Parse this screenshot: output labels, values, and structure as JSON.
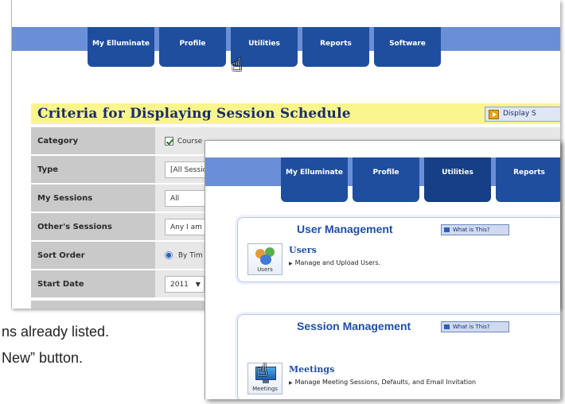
{
  "back_screen": {
    "nav_tabs": [
      "My Elluminate",
      "Profile",
      "Utilities",
      "Reports",
      "Software"
    ],
    "criteria_title": "Criteria for Displaying Session Schedule",
    "display_button": "Display S",
    "rows": [
      {
        "label": "Category",
        "value": "Course"
      },
      {
        "label": "Type",
        "value": "[All Sessio"
      },
      {
        "label": "My Sessions",
        "value": "All"
      },
      {
        "label": "Other's Sessions",
        "value": "Any I am"
      },
      {
        "label": "Sort Order",
        "value": "By Tim"
      },
      {
        "label": "Start Date",
        "value": "2011"
      }
    ]
  },
  "captions": {
    "line1": "ns already listed.",
    "line2": "New” button."
  },
  "front_screen": {
    "nav_tabs": [
      "My Elluminate",
      "Profile",
      "Utilities",
      "Reports"
    ],
    "user_panel": {
      "title": "User Management",
      "what_is_this": "What is This?",
      "icon_label": "Users",
      "item_title": "Users",
      "item_desc": "Manage and Upload Users."
    },
    "session_panel": {
      "title": "Session Management",
      "what_is_this": "What is This?",
      "icon_label": "Meetings",
      "item_title": "Meetings",
      "item_desc": "Manage Meeting Sessions, Defaults, and Email Invitation"
    }
  },
  "colors": {
    "nav_bar": "#6b8fd6",
    "nav_tab": "#1f4e9e",
    "criteria_bar": "#fbf58e",
    "row_label_bg": "#c9c9c9",
    "panel_title": "#1e4ea8"
  },
  "icons": [
    "hand-pointer-cursor",
    "checkbox-checked",
    "radio-selected",
    "users-people",
    "meetings-monitor"
  ]
}
